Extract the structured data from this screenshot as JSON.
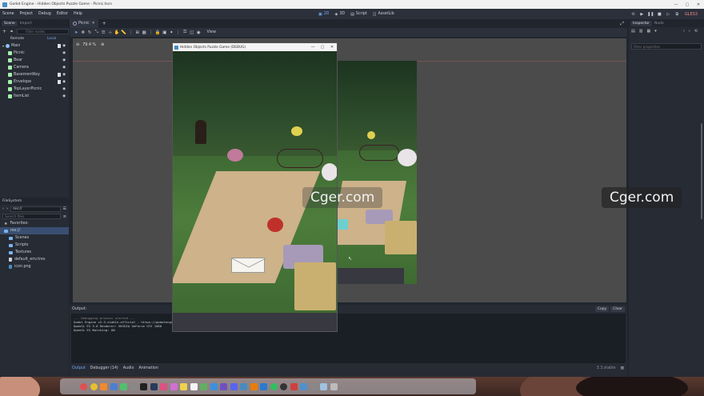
{
  "window": {
    "title": "Godot Engine - Hidden Objects Puzzle Game - Picnic.tscn",
    "controls": [
      "—",
      "▢",
      "✕"
    ]
  },
  "menubar": {
    "items": [
      "Scene",
      "Project",
      "Debug",
      "Editor",
      "Help"
    ],
    "modes": [
      "2D",
      "3D",
      "Script",
      "AssetLib"
    ],
    "renderer": "GLES3"
  },
  "scene_dock": {
    "tabs": [
      "Scene",
      "Import"
    ],
    "filter_placeholder": "Filter nodes",
    "remote": "Remote",
    "local": "Local",
    "nodes": [
      {
        "name": "Main",
        "color": "#8fc1ff",
        "script": true,
        "visible": true
      },
      {
        "name": "Picnic",
        "color": "#a5efac",
        "script": false,
        "visible": true
      },
      {
        "name": "Bear",
        "color": "#a5efac",
        "script": false,
        "visible": true
      },
      {
        "name": "Camera",
        "color": "#a5efac",
        "script": false,
        "visible": true
      },
      {
        "name": "BasementKey",
        "color": "#a5efac",
        "script": true,
        "visible": true
      },
      {
        "name": "Envelope",
        "color": "#a5efac",
        "script": true,
        "visible": true
      },
      {
        "name": "TopLayerPicnic",
        "color": "#a5efac",
        "script": false,
        "visible": true
      },
      {
        "name": "ItemList",
        "color": "#a5efac",
        "script": false,
        "visible": true
      }
    ]
  },
  "filesystem": {
    "header": "FileSystem",
    "path": "res://",
    "search_placeholder": "Search files",
    "entries": [
      {
        "label": "Favorites:",
        "type": "fav",
        "indent": false,
        "selected": false
      },
      {
        "label": "res://",
        "type": "folder",
        "indent": false,
        "selected": true
      },
      {
        "label": "Scenes",
        "type": "folder",
        "indent": true,
        "selected": false
      },
      {
        "label": "Scripts",
        "type": "folder",
        "indent": true,
        "selected": false
      },
      {
        "label": "Textures",
        "type": "folder",
        "indent": true,
        "selected": false
      },
      {
        "label": "default_env.tres",
        "type": "file",
        "indent": true,
        "selected": false
      },
      {
        "label": "icon.png",
        "type": "file",
        "indent": true,
        "selected": false
      }
    ]
  },
  "editor": {
    "scene_tab": "Picnic",
    "view_menu": "View",
    "zoom": "79.4 %"
  },
  "game_window": {
    "title": "Hidden Objects Puzzle Game (DEBUG)"
  },
  "output": {
    "label": "Output:",
    "copy": "Copy",
    "clear": "Clear",
    "lines": [
      "--- Debugging process started ---",
      "Godot Engine v3.3.stable.official - https://godotengine.org",
      "OpenGL ES 3.0 Renderer: NVIDIA GeForce GTX 1060",
      "OpenGL ES Batching: ON"
    ],
    "tabs": [
      "Output",
      "Debugger (14)",
      "Audio",
      "Animation"
    ],
    "version": "3.3.stable"
  },
  "inspector": {
    "tabs": [
      "Inspector",
      "Node"
    ],
    "filter_placeholder": "Filter properties"
  },
  "watermarks": [
    "Cger.com",
    "Cger.com"
  ]
}
